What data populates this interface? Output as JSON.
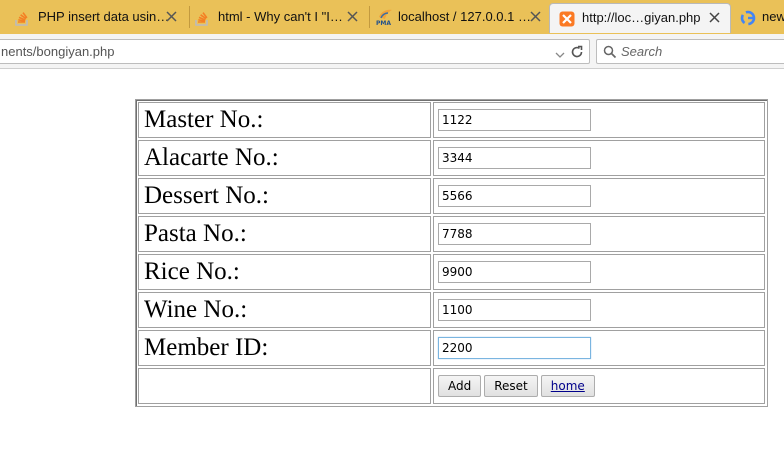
{
  "tabs": [
    {
      "title": "PHP insert data usin…",
      "icon": "stackoverflow-icon"
    },
    {
      "title": "html - Why can't I \"I…",
      "icon": "stackoverflow-icon"
    },
    {
      "title": "localhost / 127.0.0.1 …",
      "icon": "phpmyadmin-icon"
    },
    {
      "title": "http://loc…giyan.php",
      "icon": "xampp-icon"
    },
    {
      "title": "new",
      "icon": "google-icon"
    }
  ],
  "navbar": {
    "url": "nents/bongiyan.php",
    "search_placeholder": "Search"
  },
  "form": {
    "rows": [
      {
        "label": "Master No.:",
        "value": "1122"
      },
      {
        "label": "Alacarte No.:",
        "value": "3344"
      },
      {
        "label": "Dessert No.:",
        "value": "5566"
      },
      {
        "label": "Pasta No.:",
        "value": "7788"
      },
      {
        "label": "Rice No.:",
        "value": "9900"
      },
      {
        "label": "Wine No.:",
        "value": "1100"
      },
      {
        "label": "Member ID:",
        "value": "2200"
      }
    ],
    "buttons": {
      "add": "Add",
      "reset": "Reset",
      "home": "home"
    }
  },
  "colors": {
    "tabstrip": "#eac158",
    "link": "#00008b"
  }
}
